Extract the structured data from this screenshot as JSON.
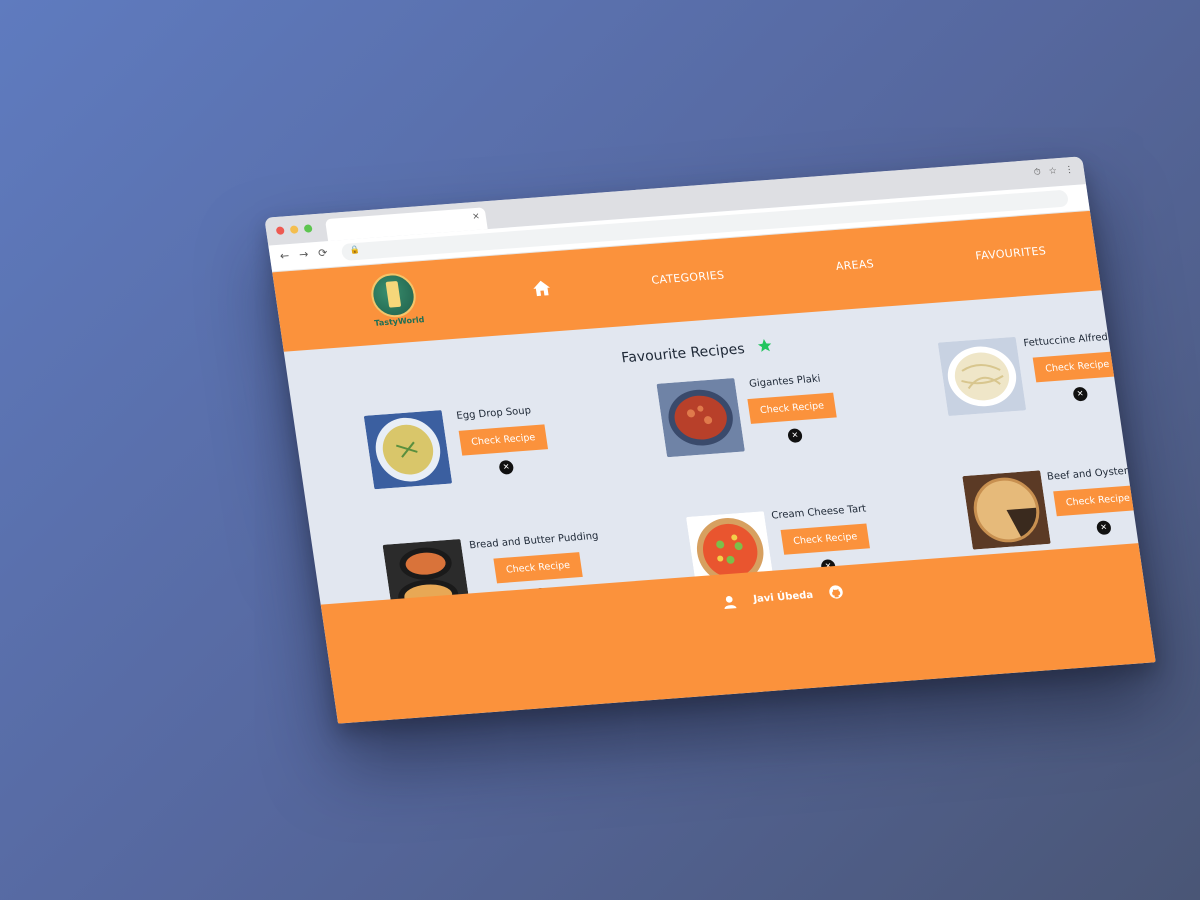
{
  "browser": {
    "tab_close": "×",
    "nav_back": "←",
    "nav_forward": "→",
    "reload": "⟳",
    "lock": "🔒",
    "top_icons": [
      "⏱",
      "☆",
      "⋮"
    ]
  },
  "header": {
    "logo_text": "TastyWorld",
    "nav": [
      "CATEGORIES",
      "AREAS",
      "FAVOURITES"
    ],
    "colors": {
      "accent": "#fb923c",
      "bg": "#e2e7f0"
    }
  },
  "main": {
    "title": "Favourite Recipes",
    "recipes": [
      {
        "name": "Egg Drop Soup",
        "button": "Check Recipe",
        "remove": "✕"
      },
      {
        "name": "Gigantes Plaki",
        "button": "Check Recipe",
        "remove": "✕"
      },
      {
        "name": "Fettuccine Alfredo",
        "button": "Check Recipe",
        "remove": "✕"
      },
      {
        "name": "Bread and Butter Pudding",
        "button": "Check Recipe",
        "remove": "✕"
      },
      {
        "name": "Cream Cheese Tart",
        "button": "Check Recipe",
        "remove": "✕"
      },
      {
        "name": "Beef and Oyster pie",
        "button": "Check Recipe",
        "remove": "✕"
      }
    ]
  },
  "footer": {
    "author": "Javi Úbeda"
  }
}
